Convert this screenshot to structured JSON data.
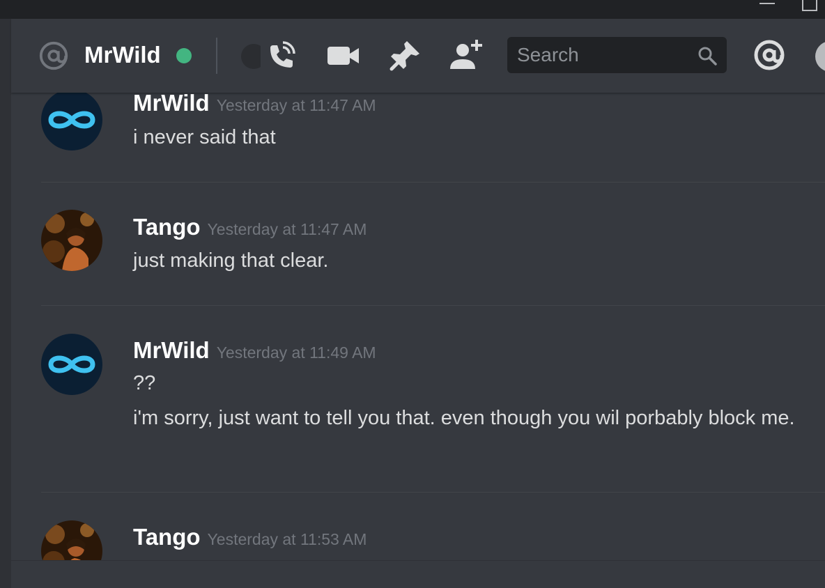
{
  "header": {
    "name": "MrWild",
    "status_color": "#43b581",
    "search_placeholder": "Search",
    "icons": [
      "at-icon",
      "call-icon",
      "video-icon",
      "pin-icon",
      "add-friend-icon",
      "search-icon",
      "mention-icon",
      "help-icon"
    ]
  },
  "messages": [
    {
      "author": "MrWild",
      "timestamp": "Yesterday at 11:47 AM",
      "lines": [
        "i never said that"
      ]
    },
    {
      "author": "Tango",
      "timestamp": "Yesterday at 11:47 AM",
      "lines": [
        "just making that clear."
      ]
    },
    {
      "author": "MrWild",
      "timestamp": "Yesterday at 11:49 AM",
      "lines": [
        "??",
        "i'm sorry, just want to tell you that. even though you wil porbably block me."
      ]
    },
    {
      "author": "Tango",
      "timestamp": "Yesterday at 11:53 AM",
      "lines": []
    }
  ],
  "colors": {
    "background": "#36393f",
    "accent_cyan": "#3fc1f0",
    "online": "#43b581"
  }
}
